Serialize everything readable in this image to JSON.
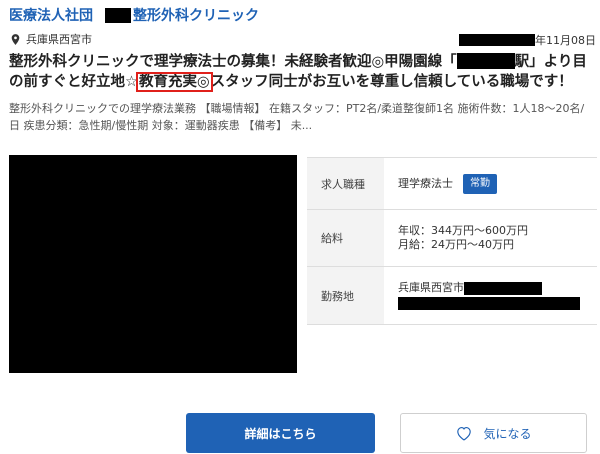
{
  "header": {
    "employer_prefix": "医療法人社団",
    "employer_suffix": "整形外科クリニック"
  },
  "location": {
    "icon": "map-pin-icon",
    "text": "兵庫県西宮市"
  },
  "posted": {
    "date_suffix": "年11月08日"
  },
  "title": {
    "part1": "整形外科クリニックで理学療法士の募集！未経験者歓迎◎甲陽園線「",
    "part2": "駅」より目の前すぐと好立地☆",
    "highlight": "教育充実◎",
    "part3": "スタッフ同士がお互いを尊重し信頼している職場です！"
  },
  "summary": {
    "text": "整形外科クリニックでの理学療法業務 【職場情報】 在籍スタッフ：PT2名/柔道整復師1名 施術件数：1人18〜20名/日 疾患分類：急性期/慢性期 対象：運動器疾患 【備考】 未..."
  },
  "info": {
    "job_type_label": "求人職種",
    "job_type_value": "理学療法士",
    "employment_badge": "常勤",
    "salary_label": "給料",
    "salary_annual": "年収：344万円〜600万円",
    "salary_monthly": "月給：24万円〜40万円",
    "workplace_label": "勤務地",
    "workplace_prefecture": "兵庫県西宮市"
  },
  "actions": {
    "details_label": "詳細はこちら",
    "favorite_label": "気になる",
    "favorite_icon": "heart-outline-icon"
  },
  "colors": {
    "brand_blue": "#1f62b5",
    "highlight_red": "#e0201b"
  }
}
